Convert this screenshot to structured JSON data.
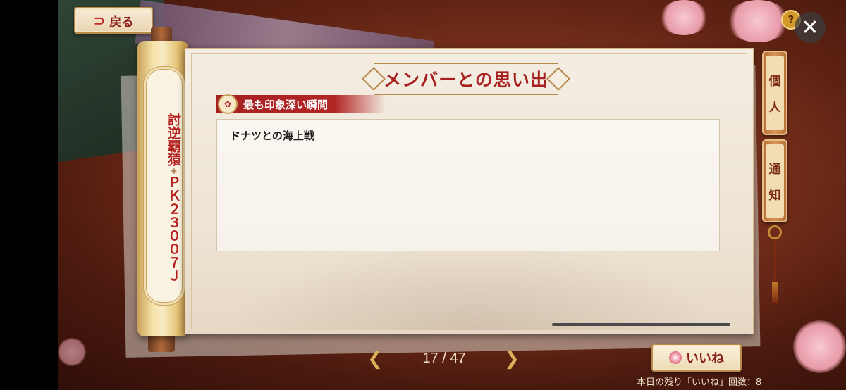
{
  "header": {
    "back_label": "戻る",
    "help_label": "?",
    "close_label": "✕"
  },
  "roll": {
    "line1": "討逆覇猿",
    "separator": "◈",
    "line2": "ＰＫ２３００７Ｊ"
  },
  "panel": {
    "title": "メンバーとの思い出",
    "section_label": "最も印象深い瞬間",
    "content": "ドナツとの海上戦"
  },
  "side_tabs": [
    {
      "label": "個人",
      "chars": [
        "個",
        "人"
      ]
    },
    {
      "label": "通知",
      "chars": [
        "通",
        "知"
      ]
    }
  ],
  "pager": {
    "prev_icon": "chevron-left-icon",
    "next_icon": "chevron-right-icon",
    "current": 17,
    "total": 47,
    "text": "17 / 47"
  },
  "like": {
    "label": "いいね",
    "remaining_text": "本日の残り「いいね」回数：8"
  }
}
